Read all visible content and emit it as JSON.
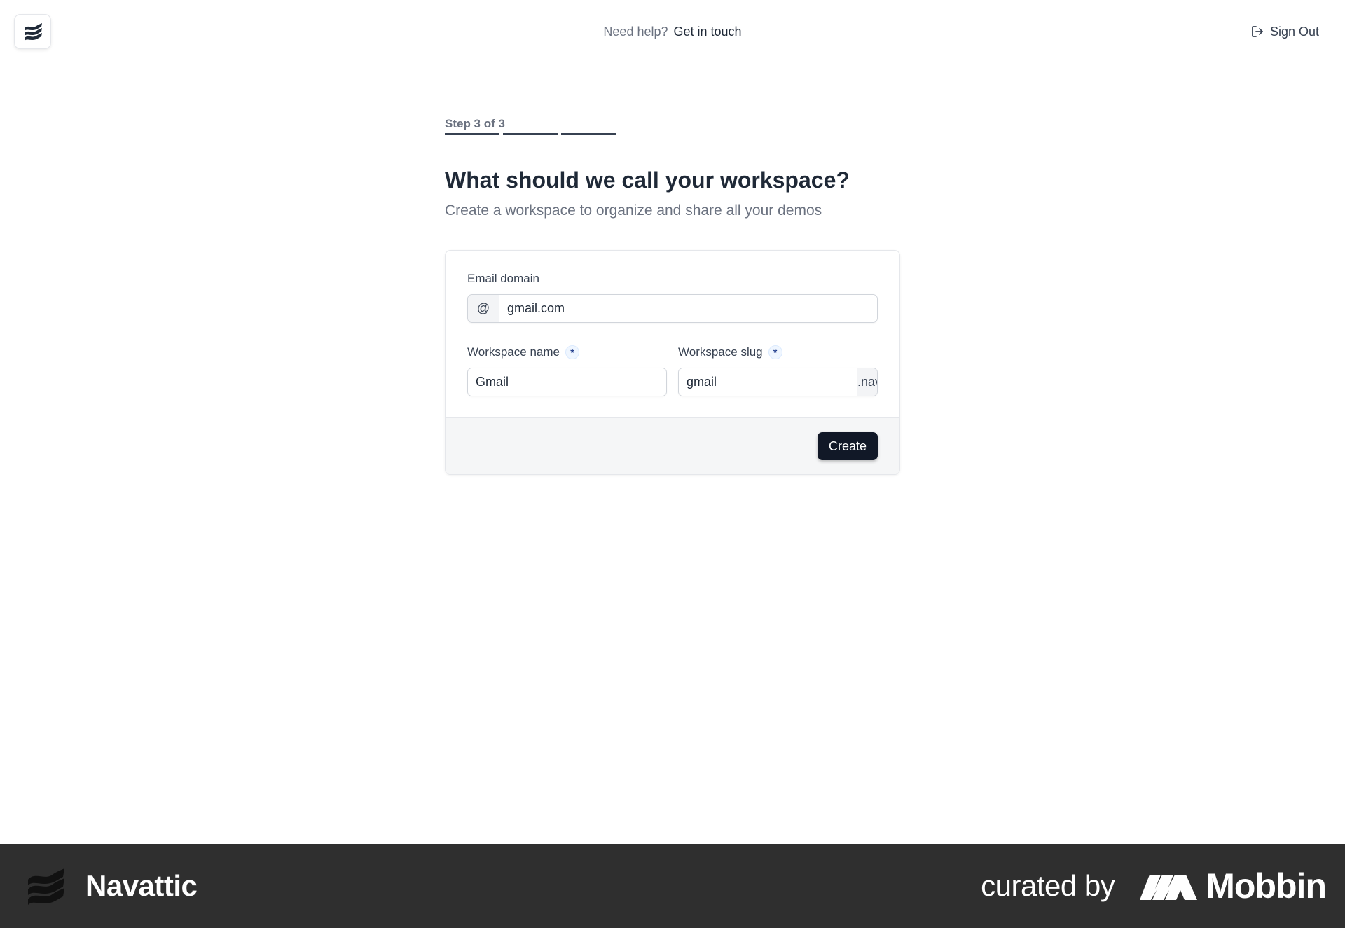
{
  "header": {
    "help_text": "Need help?",
    "help_link": "Get in touch",
    "sign_out": "Sign Out"
  },
  "steps": {
    "label": "Step 3 of 3",
    "current": 3,
    "total": 3
  },
  "page": {
    "title": "What should we call your workspace?",
    "subtitle": "Create a workspace to organize and share all your demos"
  },
  "form": {
    "email_domain": {
      "label": "Email domain",
      "prefix": "@",
      "value": "gmail.com"
    },
    "workspace_name": {
      "label": "Workspace name",
      "required_mark": "*",
      "value": "Gmail"
    },
    "workspace_slug": {
      "label": "Workspace slug",
      "required_mark": "*",
      "value": "gmail",
      "suffix": ".navattic.com"
    },
    "submit_label": "Create"
  },
  "banner": {
    "brand": "Navattic",
    "curated_by": "curated by",
    "curator": "Mobbin"
  }
}
